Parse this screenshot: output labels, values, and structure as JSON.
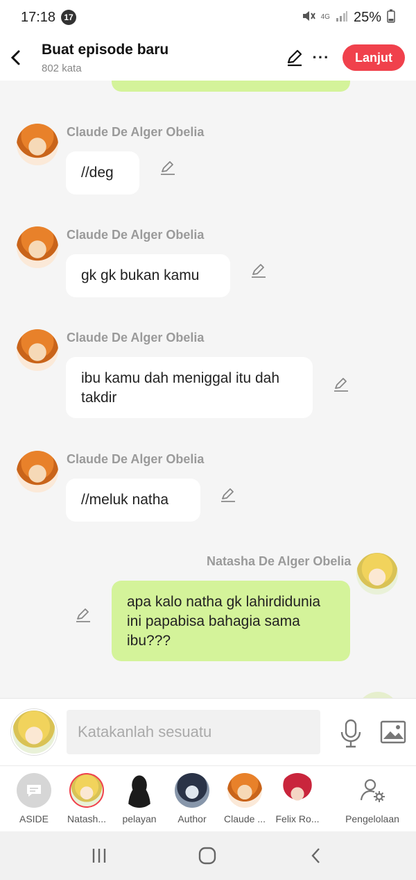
{
  "status_bar": {
    "time": "17:18",
    "notification_count": "17",
    "network_label": "4G",
    "battery": "25%"
  },
  "header": {
    "title": "Buat episode baru",
    "subtitle": "802 kata",
    "continue_label": "Lanjut",
    "more_label": "···"
  },
  "messages": [
    {
      "sender": "Claude De Alger Obelia",
      "text": "//deg"
    },
    {
      "sender": "Claude De Alger Obelia",
      "text": "gk gk bukan kamu"
    },
    {
      "sender": "Claude De Alger Obelia",
      "text": "ibu kamu dah meniggal itu dah takdir"
    },
    {
      "sender": "Claude De Alger Obelia",
      "text": "//meluk natha"
    },
    {
      "sender": "Natasha De Alger Obelia",
      "text": "apa kalo natha gk lahirdidunia ini papabisa bahagia sama ibu???"
    }
  ],
  "input": {
    "placeholder": "Katakanlah sesuatu"
  },
  "characters": [
    {
      "label": "ASIDE"
    },
    {
      "label": "Natash..."
    },
    {
      "label": "pelayan"
    },
    {
      "label": "Author"
    },
    {
      "label": "Claude ..."
    },
    {
      "label": "Felix Ro..."
    },
    {
      "label": "Pengelolaan"
    }
  ],
  "colors": {
    "accent": "#f0414c",
    "bubble_self": "#d4f39a",
    "bubble_other": "#ffffff",
    "background": "#f5f5f5"
  }
}
